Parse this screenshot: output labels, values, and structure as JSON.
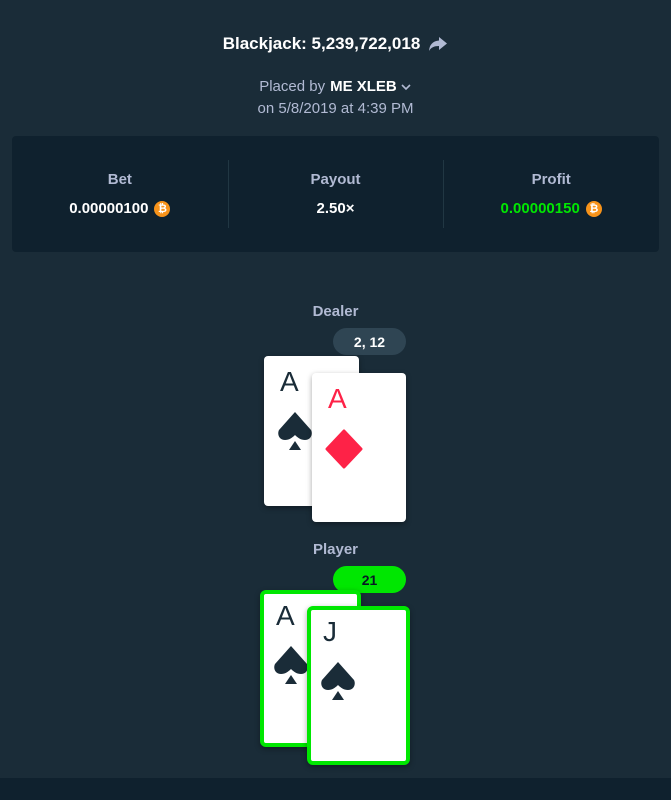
{
  "header": {
    "title": "Blackjack: 5,239,722,018",
    "placed_by_prefix": "Placed by",
    "username": "ME XLEB",
    "date_line": "on 5/8/2019 at 4:39 PM"
  },
  "stats": {
    "bet_label": "Bet",
    "bet_value": "0.00000100",
    "payout_label": "Payout",
    "payout_value": "2.50×",
    "profit_label": "Profit",
    "profit_value": "0.00000150",
    "currency_symbol": "₿"
  },
  "dealer": {
    "label": "Dealer",
    "score": "2, 12",
    "cards": [
      {
        "rank": "A",
        "suit": "spades",
        "color": "black"
      },
      {
        "rank": "A",
        "suit": "diamonds",
        "color": "red"
      }
    ]
  },
  "player": {
    "label": "Player",
    "score": "21",
    "cards": [
      {
        "rank": "A",
        "suit": "spades",
        "color": "black"
      },
      {
        "rank": "J",
        "suit": "spades",
        "color": "black"
      }
    ]
  },
  "colors": {
    "background": "#1a2c38",
    "panel": "#0f212e",
    "win_green": "#00e701",
    "red_suit": "#fe2247",
    "coin": "#f7931a"
  }
}
